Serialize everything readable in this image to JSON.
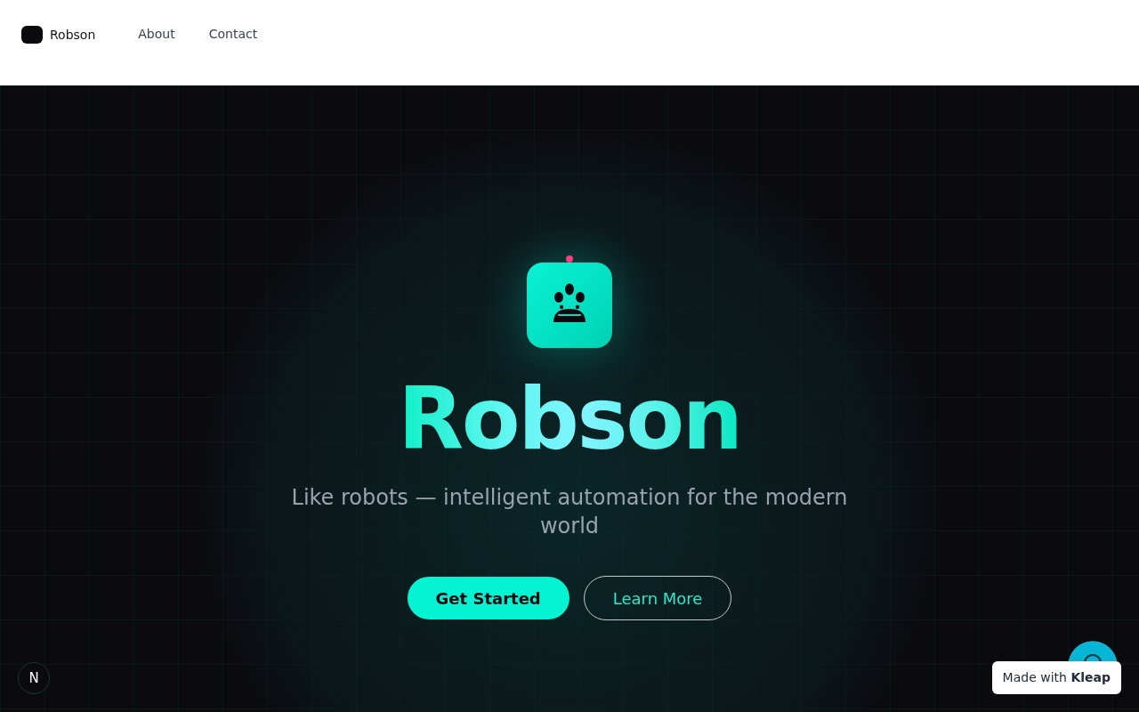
{
  "header": {
    "brand": "Robson",
    "nav": [
      {
        "label": "About"
      },
      {
        "label": "Contact"
      }
    ]
  },
  "hero": {
    "title": "Robson",
    "subtitle": "Like robots — intelligent automation for the modern world",
    "buttons": [
      {
        "label": "Get Started",
        "kind": "primary"
      },
      {
        "label": "Learn More",
        "kind": "outline"
      }
    ]
  },
  "dev_badge": {
    "letter": "N"
  },
  "made_with": "Made with **Kleap**"
}
